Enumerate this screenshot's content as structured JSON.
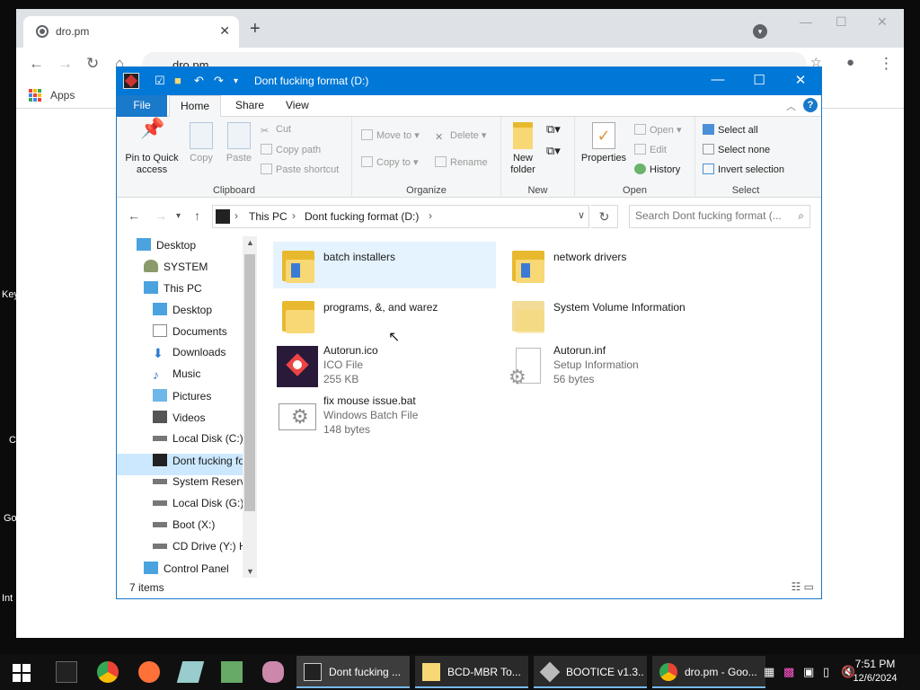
{
  "desktop": {
    "edge_labels": [
      "Key",
      "C",
      "Go",
      "Int"
    ]
  },
  "chrome": {
    "tab_title": "dro.pm",
    "tab_close": "✕",
    "new_tab": "+",
    "address": "dro.pm",
    "apps_label": "Apps"
  },
  "explorer": {
    "title": "Dont fucking format (D:)",
    "ribbon_tabs": {
      "file": "File",
      "home": "Home",
      "share": "Share",
      "view": "View"
    },
    "clipboard": {
      "label": "Clipboard",
      "pin_label": "Pin to Quick access",
      "copy_label": "Copy",
      "paste_label": "Paste",
      "cut_label": "Cut",
      "copy_path_label": "Copy path",
      "paste_shortcut_label": "Paste shortcut"
    },
    "organize": {
      "label": "Organize",
      "move_to_label": "Move to",
      "copy_to_label": "Copy to",
      "delete_label": "Delete",
      "rename_label": "Rename"
    },
    "new_group": {
      "label": "New",
      "new_folder_label": "New folder"
    },
    "open_group": {
      "label": "Open",
      "properties_label": "Properties",
      "open_label": "Open",
      "edit_label": "Edit",
      "history_label": "History"
    },
    "select_group": {
      "label": "Select",
      "select_all_label": "Select all",
      "select_none_label": "Select none",
      "invert_label": "Invert selection"
    },
    "address": {
      "crumb1": "This PC",
      "crumb2": "Dont fucking format (D:)"
    },
    "search_placeholder": "Search Dont fucking format (...",
    "nav_items": [
      {
        "label": "Desktop",
        "icon": "desktop-icon"
      },
      {
        "label": "SYSTEM",
        "icon": "user-icon"
      },
      {
        "label": "This PC",
        "icon": "pc-icon"
      },
      {
        "label": "Desktop",
        "icon": "desktop-icon"
      },
      {
        "label": "Documents",
        "icon": "documents-icon"
      },
      {
        "label": "Downloads",
        "icon": "downloads-icon"
      },
      {
        "label": "Music",
        "icon": "music-icon"
      },
      {
        "label": "Pictures",
        "icon": "pictures-icon"
      },
      {
        "label": "Videos",
        "icon": "videos-icon"
      },
      {
        "label": "Local Disk (C:)",
        "icon": "drive-icon"
      },
      {
        "label": "Dont fucking fo",
        "icon": "drive-icon"
      },
      {
        "label": "System Reserve",
        "icon": "drive-icon"
      },
      {
        "label": "Local Disk (G:)",
        "icon": "drive-icon"
      },
      {
        "label": "Boot (X:)",
        "icon": "drive-icon"
      },
      {
        "label": "CD Drive (Y:) H",
        "icon": "cd-drive-icon"
      },
      {
        "label": "Control Panel",
        "icon": "control-panel-icon"
      }
    ],
    "files": [
      {
        "name": "batch installers",
        "type": "",
        "size": ""
      },
      {
        "name": "network drivers",
        "type": "",
        "size": ""
      },
      {
        "name": "programs, &, and warez",
        "type": "",
        "size": ""
      },
      {
        "name": "System Volume Information",
        "type": "",
        "size": ""
      },
      {
        "name": "Autorun.ico",
        "type": "ICO File",
        "size": "255 KB"
      },
      {
        "name": "Autorun.inf",
        "type": "Setup Information",
        "size": "56 bytes"
      },
      {
        "name": "fix mouse issue.bat",
        "type": "Windows Batch File",
        "size": "148 bytes"
      }
    ],
    "status": "7 items"
  },
  "taskbar": {
    "tasks": [
      {
        "label": "Dont fucking ..."
      },
      {
        "label": "BCD-MBR To..."
      },
      {
        "label": "BOOTICE v1.3..."
      },
      {
        "label": "dro.pm - Goo..."
      }
    ],
    "time": "7:51 PM",
    "date": "12/6/2024"
  },
  "colors": {
    "title_blue": "#0078d7",
    "selection": "#cce8ff",
    "hover": "#e5f3ff",
    "folder": "#f8d775"
  }
}
